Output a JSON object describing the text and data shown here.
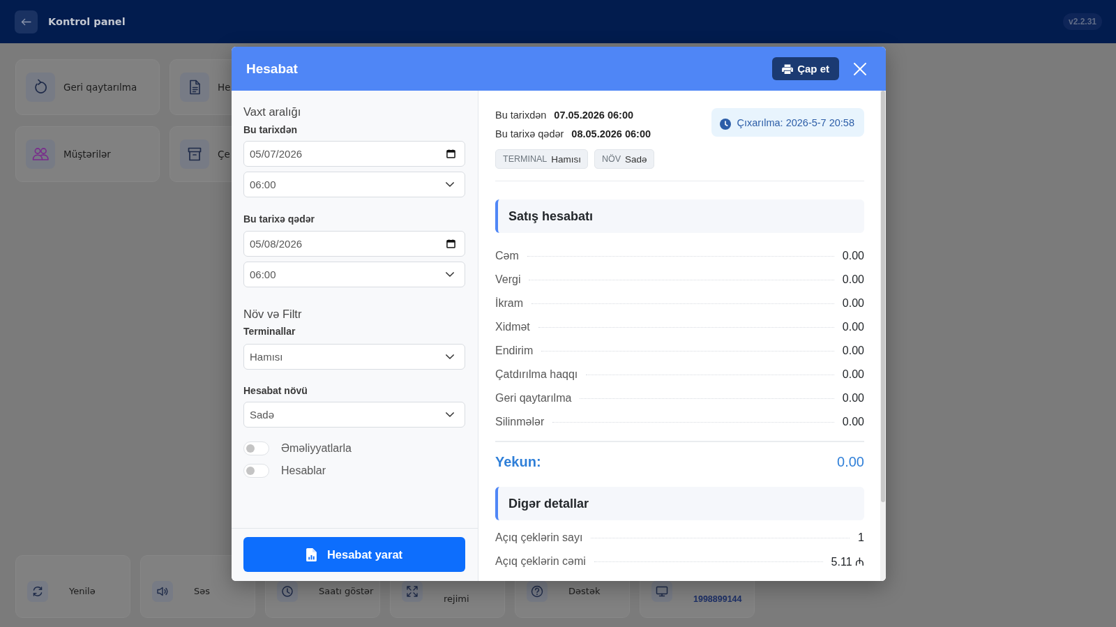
{
  "top_bar": {
    "title": "Kontrol panel",
    "version": "v2.2.31"
  },
  "dashboard": {
    "tiles": [
      {
        "label": "Geri qaytarılma"
      },
      {
        "label": "He"
      },
      {
        "label": "Müştərilər"
      },
      {
        "label": "Çe"
      }
    ],
    "bottom_tiles": [
      {
        "label": "Yenilə",
        "kind": "label"
      },
      {
        "label": "Səs",
        "kind": "label"
      },
      {
        "label": "Saatı göstər",
        "kind": "label"
      },
      {
        "label": "rejimi",
        "kind": "subline"
      },
      {
        "label": "Dəstək",
        "kind": "label"
      },
      {
        "label": "1998899144",
        "kind": "number"
      }
    ]
  },
  "report_dialog": {
    "title": "Hesabat",
    "print_button": "Çap et",
    "filters": {
      "time_range_heading": "Vaxt aralığı",
      "from": {
        "label": "Bu tarixdən",
        "date": "05/07/2026",
        "time": "06:00"
      },
      "to": {
        "label": "Bu tarixə qədər",
        "date": "05/08/2026",
        "time": "06:00"
      },
      "type_heading": "Növ və Filtr",
      "terminals": {
        "label": "Terminallar",
        "value": "Hamısı"
      },
      "report_type": {
        "label": "Hesabat növü",
        "value": "Sadə"
      },
      "toggles": [
        {
          "label": "Əməliyyatlarla",
          "on": false
        },
        {
          "label": "Hesablar",
          "on": false
        }
      ],
      "generate_button": "Hesabat yarat"
    },
    "report": {
      "period": [
        {
          "label": "Bu tarixdən",
          "value": "07.05.2026 06:00"
        },
        {
          "label": "Bu tarixə qədər",
          "value": "08.05.2026 06:00"
        }
      ],
      "chips": [
        {
          "label": "TERMINAL",
          "value": "Hamısı"
        },
        {
          "label": "NÖV",
          "value": "Sadə"
        }
      ],
      "generated": "Çıxarılma: 2026-5-7 20:58",
      "sections": [
        {
          "title": "Satış hesabatı",
          "rows": [
            {
              "label": "Cəm",
              "value": "0.00"
            },
            {
              "label": "Vergi",
              "value": "0.00"
            },
            {
              "label": "İkram",
              "value": "0.00"
            },
            {
              "label": "Xidmət",
              "value": "0.00"
            },
            {
              "label": "Endirim",
              "value": "0.00"
            },
            {
              "label": "Çatdırılma haqqı",
              "value": "0.00"
            },
            {
              "label": "Geri qaytarılma",
              "value": "0.00"
            },
            {
              "label": "Silinmələr",
              "value": "0.00"
            }
          ],
          "total": {
            "label": "Yekun:",
            "value": "0.00"
          }
        },
        {
          "title": "Digər detallar",
          "rows": [
            {
              "label": "Açıq çeklərin sayı",
              "value": "1"
            },
            {
              "label": "Açıq çeklərin cəmi",
              "value": "5.11 ₼"
            }
          ]
        }
      ]
    }
  }
}
